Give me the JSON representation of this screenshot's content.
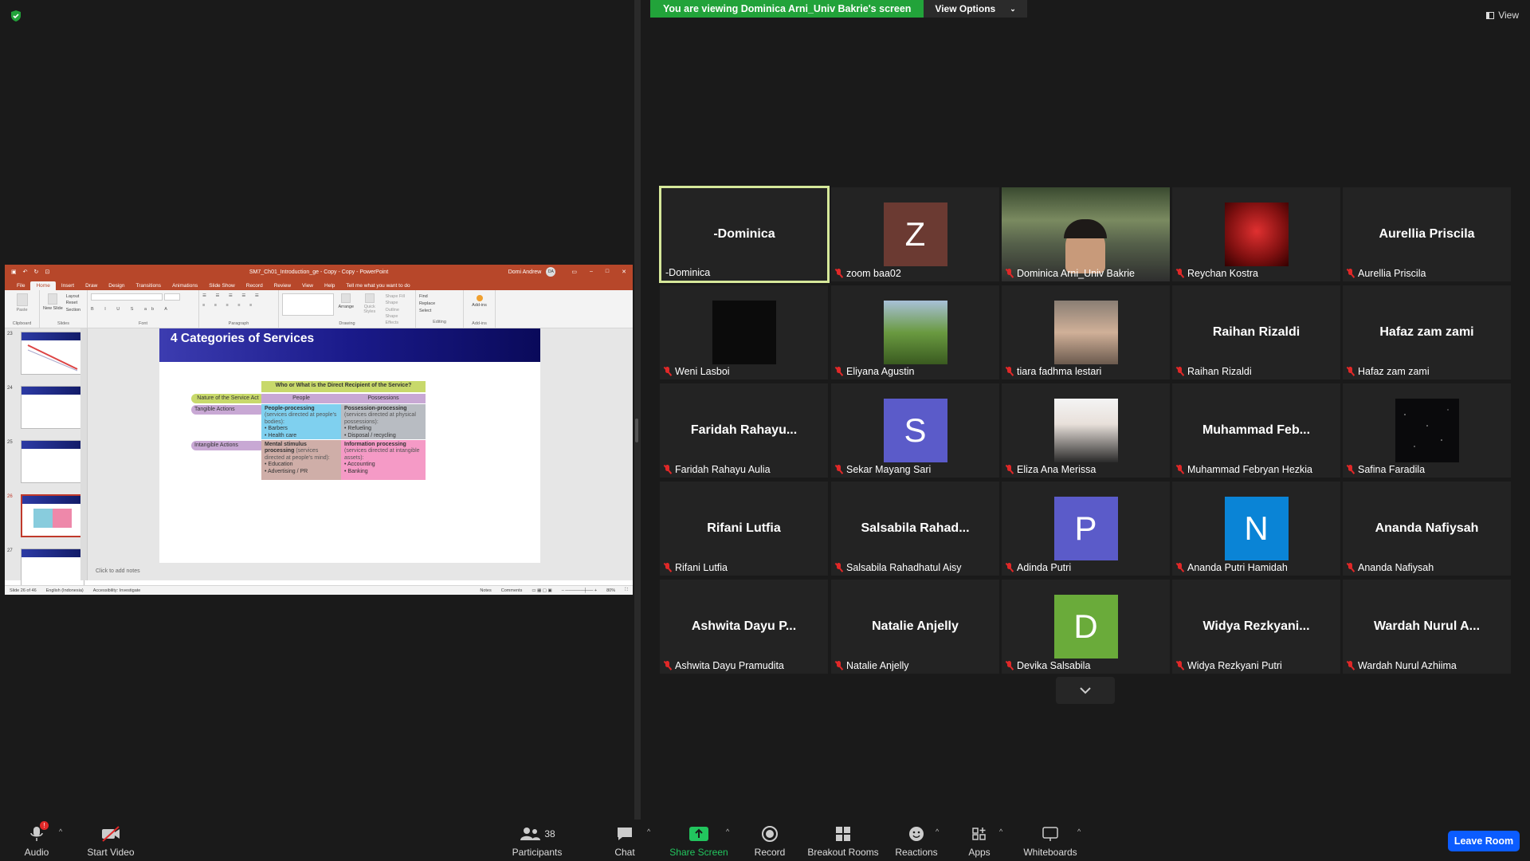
{
  "banner": {
    "viewing": "You are viewing Dominica Arni_Univ Bakrie's screen",
    "view_options": "View Options"
  },
  "view_label": "View",
  "ppt": {
    "doc_title": "SM7_Ch01_Introduction_ge - Copy - Copy - PowerPoint",
    "user": "Domi Andrew",
    "user_initials": "DA",
    "tabs": [
      "File",
      "Home",
      "Insert",
      "Draw",
      "Design",
      "Transitions",
      "Animations",
      "Slide Show",
      "Record",
      "Review",
      "View",
      "Help",
      "Tell me what you want to do"
    ],
    "groups": [
      "Clipboard",
      "Slides",
      "Font",
      "Paragraph",
      "Drawing",
      "Editing",
      "Add-ins"
    ],
    "ribbon_buttons": {
      "paste": "Paste",
      "new_slide": "New Slide",
      "layout": "Layout",
      "reset": "Reset",
      "section": "Section",
      "arrange": "Arrange",
      "quick_styles": "Quick Styles",
      "shape_fill": "Shape Fill",
      "shape_outline": "Shape Outline",
      "shape_effects": "Shape Effects",
      "find": "Find",
      "replace": "Replace",
      "select": "Select",
      "addins": "Add-ins"
    },
    "thumb_numbers": [
      "23",
      "24",
      "25",
      "26",
      "27"
    ],
    "slide_title": "4 Categories of Services",
    "matrix": {
      "top_header": "Who or What is the Direct Recipient of the Service?",
      "row_header": "Nature of the Service Act",
      "col_people": "People",
      "col_possessions": "Possessions",
      "row_tangible": "Tangible Actions",
      "row_intangible": "Intangible Actions",
      "c1_title": "People-processing",
      "c1_sub": "(services directed at people's bodies):",
      "c1_items": [
        "Barbers",
        "Health care"
      ],
      "c2_title": "Possession-processing",
      "c2_sub": "(services directed at physical possessions):",
      "c2_items": [
        "Refueling",
        "Disposal / recycling"
      ],
      "c3_title": "Mental stimulus processing",
      "c3_sub": "(services directed at people's mind):",
      "c3_items": [
        "Education",
        "Advertising / PR"
      ],
      "c4_title": "Information processing",
      "c4_sub": "(services directed at intangible assets):",
      "c4_items": [
        "Accounting",
        "Banking"
      ]
    },
    "notes": "Click to add notes",
    "status": {
      "slide": "Slide 26 of 46",
      "lang": "English (Indonesia)",
      "accessibility": "Accessibility: Investigate",
      "notes_btn": "Notes",
      "comments_btn": "Comments",
      "zoom": "80%"
    }
  },
  "participants": [
    {
      "center": "-Dominica",
      "label": "-Dominica",
      "type": "name",
      "muted": false,
      "active": true
    },
    {
      "center": "Z",
      "label": "zoom baa02",
      "type": "letter",
      "color": "#6b3a32",
      "muted": true
    },
    {
      "center": "",
      "label": "Dominica Arni_Univ Bakrie",
      "type": "video",
      "muted": true
    },
    {
      "center": "",
      "label": "Reychan Kostra",
      "type": "photo-red",
      "muted": true
    },
    {
      "center": "Aurellia Priscila",
      "label": "Aurellia Priscila",
      "type": "name",
      "muted": true
    },
    {
      "center": "",
      "label": "Weni Lasboi",
      "type": "photo-black",
      "muted": true
    },
    {
      "center": "",
      "label": "Eliyana Agustin",
      "type": "photo-green",
      "muted": true
    },
    {
      "center": "",
      "label": "tiara fadhma lestari",
      "type": "photo-face",
      "muted": true
    },
    {
      "center": "Raihan Rizaldi",
      "label": "Raihan Rizaldi",
      "type": "name",
      "muted": true
    },
    {
      "center": "Hafaz zam zami",
      "label": "Hafaz zam zami",
      "type": "name",
      "muted": true
    },
    {
      "center": "Faridah  Rahayu...",
      "label": "Faridah Rahayu Aulia",
      "type": "name",
      "muted": true
    },
    {
      "center": "S",
      "label": "Sekar Mayang Sari",
      "type": "letter",
      "color": "#5b5bc9",
      "muted": true
    },
    {
      "center": "",
      "label": "Eliza Ana Merissa",
      "type": "photo-white",
      "muted": true
    },
    {
      "center": "Muhammad  Feb...",
      "label": "Muhammad Febryan Hezkia",
      "type": "name",
      "muted": true
    },
    {
      "center": "",
      "label": "Safina Faradila",
      "type": "photo-stars",
      "muted": true
    },
    {
      "center": "Rifani Lutfia",
      "label": "Rifani Lutfia",
      "type": "name",
      "muted": true
    },
    {
      "center": "Salsabila  Rahad...",
      "label": "Salsabila Rahadhatul Aisy",
      "type": "name",
      "muted": true
    },
    {
      "center": "P",
      "label": "Adinda Putri",
      "type": "letter",
      "color": "#5b5bc9",
      "muted": true
    },
    {
      "center": "N",
      "label": "Ananda Putri Hamidah",
      "type": "letter",
      "color": "#0a84d6",
      "muted": true
    },
    {
      "center": "Ananda Nafiysah",
      "label": "Ananda Nafiysah",
      "type": "name",
      "muted": true
    },
    {
      "center": "Ashwita Dayu P...",
      "label": "Ashwita Dayu Pramudita",
      "type": "name",
      "muted": true
    },
    {
      "center": "Natalie Anjelly",
      "label": "Natalie Anjelly",
      "type": "name",
      "muted": true
    },
    {
      "center": "D",
      "label": "Devika Salsabila",
      "type": "letter",
      "color": "#6aab3a",
      "muted": true
    },
    {
      "center": "Widya  Rezkyani...",
      "label": "Widya Rezkyani Putri",
      "type": "name",
      "muted": true
    },
    {
      "center": "Wardah Nurul A...",
      "label": "Wardah Nurul Azhiima",
      "type": "name",
      "muted": true
    }
  ],
  "toolbar": {
    "audio": "Audio",
    "start_video": "Start Video",
    "participants": "Participants",
    "participants_count": "38",
    "chat": "Chat",
    "share_screen": "Share Screen",
    "record": "Record",
    "breakout": "Breakout Rooms",
    "reactions": "Reactions",
    "apps": "Apps",
    "whiteboards": "Whiteboards",
    "leave": "Leave Room"
  },
  "colors": {
    "share_green": "#22a33a",
    "leave_blue": "#0b5cff",
    "active_speaker": "#d6e89a",
    "mute_red": "#e02828"
  }
}
